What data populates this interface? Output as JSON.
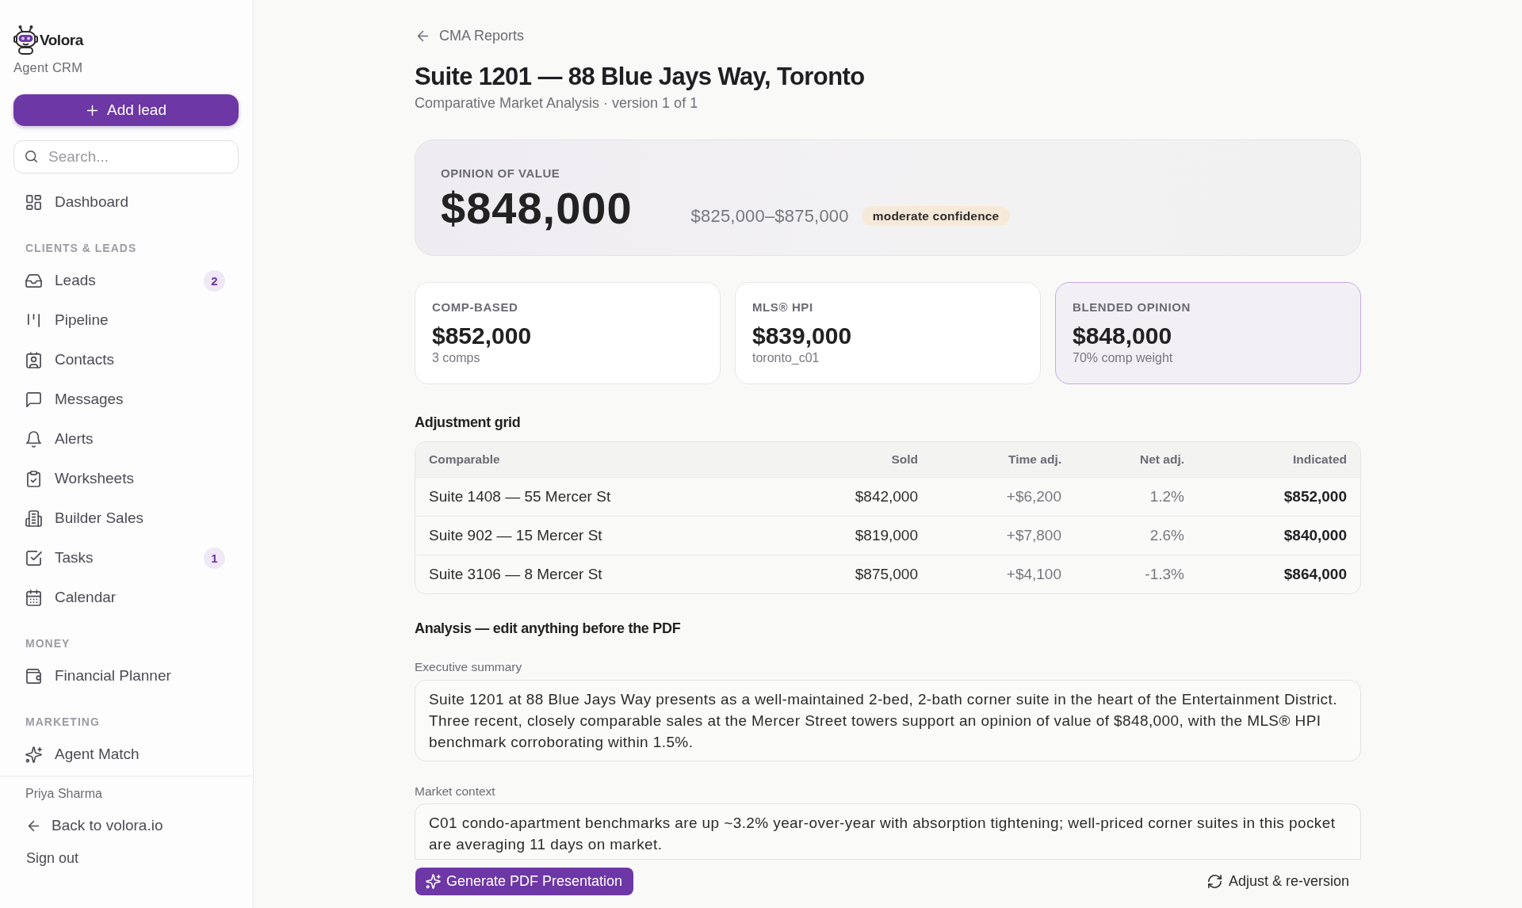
{
  "sidebar": {
    "brand": {
      "name": "Volora",
      "subtitle": "Agent CRM"
    },
    "add_button": {
      "label": "Add lead"
    },
    "search": {
      "placeholder": "Search..."
    },
    "sections": [
      {
        "items": [
          {
            "label": "Dashboard",
            "selected": false
          }
        ]
      },
      {
        "heading": "CLIENTS & LEADS",
        "items": [
          {
            "label": "Leads",
            "badge": "2",
            "selected": false
          },
          {
            "label": "Pipeline",
            "selected": false
          },
          {
            "label": "Contacts",
            "selected": false
          },
          {
            "label": "Messages",
            "selected": false
          },
          {
            "label": "Alerts",
            "selected": false
          },
          {
            "label": "Worksheets",
            "selected": false
          },
          {
            "label": "Builder Sales",
            "selected": false
          },
          {
            "label": "Tasks",
            "badge": "1",
            "selected": false
          },
          {
            "label": "Calendar",
            "selected": false
          }
        ]
      },
      {
        "heading": "MONEY",
        "items": [
          {
            "label": "Financial Planner",
            "selected": false
          }
        ]
      },
      {
        "heading": "MARKETING",
        "items": [
          {
            "label": "Agent Match",
            "selected": false
          }
        ]
      }
    ],
    "footer": {
      "user_name": "Priya Sharma",
      "back_link": "Back to volora.io",
      "sign_out": "Sign out"
    }
  },
  "breadcrumb": "CMA Reports",
  "title": "Suite 1201 — 88 Blue Jays Way, Toronto",
  "subtitle": "Comparative Market Analysis · version 1 of 1",
  "opinion": {
    "label": "OPINION OF VALUE",
    "value": "$848,000",
    "range": "$825,000–$875,000",
    "confidence": "moderate confidence"
  },
  "summary_cards": [
    {
      "label": "COMP-BASED",
      "value": "$852,000",
      "note": "3 comps",
      "highlighted": false
    },
    {
      "label": "MLS® HPI",
      "value": "$839,000",
      "note": "toronto_c01",
      "highlighted": false
    },
    {
      "label": "BLENDED OPINION",
      "value": "$848,000",
      "note": "70% comp weight",
      "highlighted": true
    }
  ],
  "adjustment_grid": {
    "title": "Adjustment grid",
    "columns": [
      "Comparable",
      "Sold",
      "Time adj.",
      "Net adj.",
      "Indicated"
    ],
    "rows": [
      [
        "Suite 1408 — 55 Mercer St",
        "$842,000",
        "+$6,200",
        "1.2%",
        "$852,000"
      ],
      [
        "Suite 902 — 15 Mercer St",
        "$819,000",
        "+$7,800",
        "2.6%",
        "$840,000"
      ],
      [
        "Suite 3106 — 8 Mercer St",
        "$875,000",
        "+$4,100",
        "-1.3%",
        "$864,000"
      ]
    ]
  },
  "analysis": {
    "title": "Analysis — edit anything before the PDF",
    "fields": [
      {
        "label": "Executive summary",
        "value": "Suite 1201 at 88 Blue Jays Way presents as a well-maintained 2-bed, 2-bath corner suite in the heart of the Entertainment District. Three recent, closely comparable sales at the Mercer Street towers support an opinion of value of $848,000, with the MLS® HPI benchmark corroborating within 1.5%."
      },
      {
        "label": "Market context",
        "value": "C01 condo-apartment benchmarks are up ~3.2% year-over-year with absorption tightening; well-priced corner suites in this pocket are averaging 11 days on market."
      }
    ]
  },
  "actions": {
    "primary": "Generate PDF Presentation",
    "secondary": "Adjust & re-version"
  }
}
